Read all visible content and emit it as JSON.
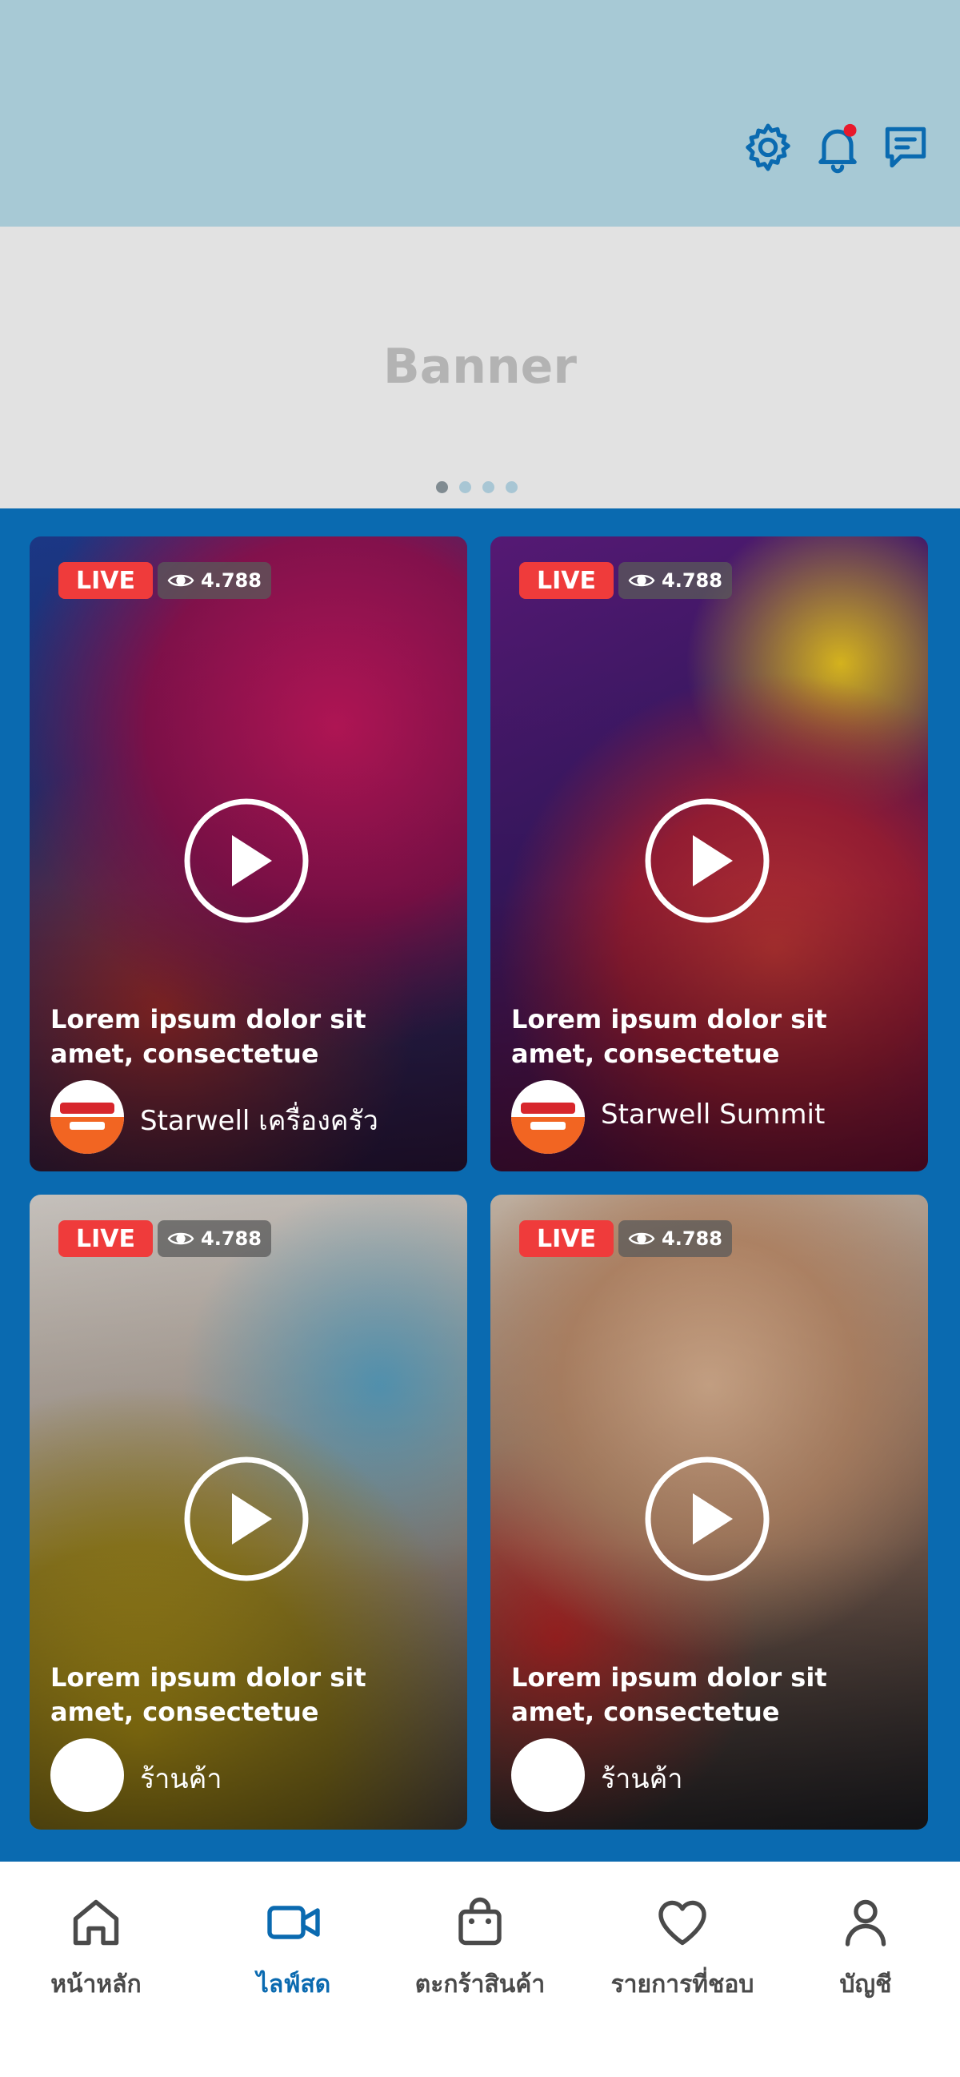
{
  "colors": {
    "header_bg": "#a7c9d5",
    "brand_blue": "#0a6ab0",
    "live_red": "#ef3b3b",
    "notification_dot": "#e8192c"
  },
  "header": {
    "icons": [
      "gear-icon",
      "bell-icon",
      "chat-icon"
    ],
    "has_notification": true
  },
  "banner": {
    "label": "Banner",
    "slides_total": 4,
    "active_slide": 1
  },
  "cards": [
    {
      "live_label": "LIVE",
      "views": "4.788",
      "title": "Lorem ipsum dolor sit amet, consectetue",
      "shop": "Starwell เครื่องครัว",
      "has_logo": true
    },
    {
      "live_label": "LIVE",
      "views": "4.788",
      "title": "Lorem ipsum dolor sit amet, consectetue",
      "shop": "Starwell Summit",
      "has_logo": true
    },
    {
      "live_label": "LIVE",
      "views": "4.788",
      "title": "Lorem ipsum dolor sit amet, consectetue",
      "shop": "ร้านค้า",
      "has_logo": false
    },
    {
      "live_label": "LIVE",
      "views": "4.788",
      "title": "Lorem ipsum dolor sit amet, consectetue",
      "shop": "ร้านค้า",
      "has_logo": false
    }
  ],
  "nav": {
    "items": [
      {
        "label": "หน้าหลัก",
        "icon": "home-icon"
      },
      {
        "label": "ไลฟ์สด",
        "icon": "video-icon"
      },
      {
        "label": "ตะกร้าสินค้า",
        "icon": "shopping-bag-icon"
      },
      {
        "label": "รายการที่ชอบ",
        "icon": "heart-icon"
      },
      {
        "label": "บัญชี",
        "icon": "user-icon"
      }
    ],
    "active_index": 1
  }
}
